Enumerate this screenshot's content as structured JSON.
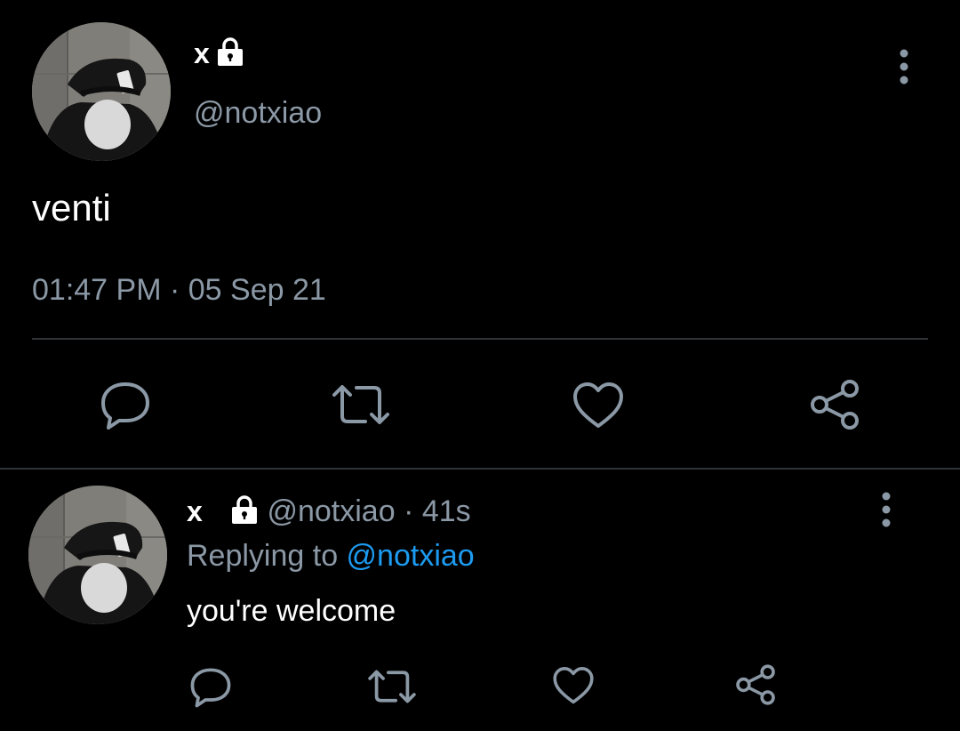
{
  "main_tweet": {
    "display_name": "x",
    "handle": "@notxiao",
    "text": "venti",
    "time": "01:47 PM",
    "separator": " · ",
    "date": "05 Sep 21",
    "protected": true
  },
  "reply_tweet": {
    "display_name": "x",
    "handle": "@notxiao",
    "separator": " · ",
    "age": "41s",
    "replying_label": "Replying to ",
    "replying_to": "@notxiao",
    "text": "you're welcome",
    "protected": true
  },
  "icons": {
    "lock": "lock-icon",
    "more": "more-vertical-icon",
    "reply": "reply-icon",
    "retweet": "retweet-icon",
    "like": "heart-icon",
    "share": "share-icon"
  },
  "colors": {
    "background": "#000000",
    "primary_text": "#ffffff",
    "secondary_text": "#8b98a5",
    "link": "#1d9bf0",
    "divider": "#2f3336"
  }
}
